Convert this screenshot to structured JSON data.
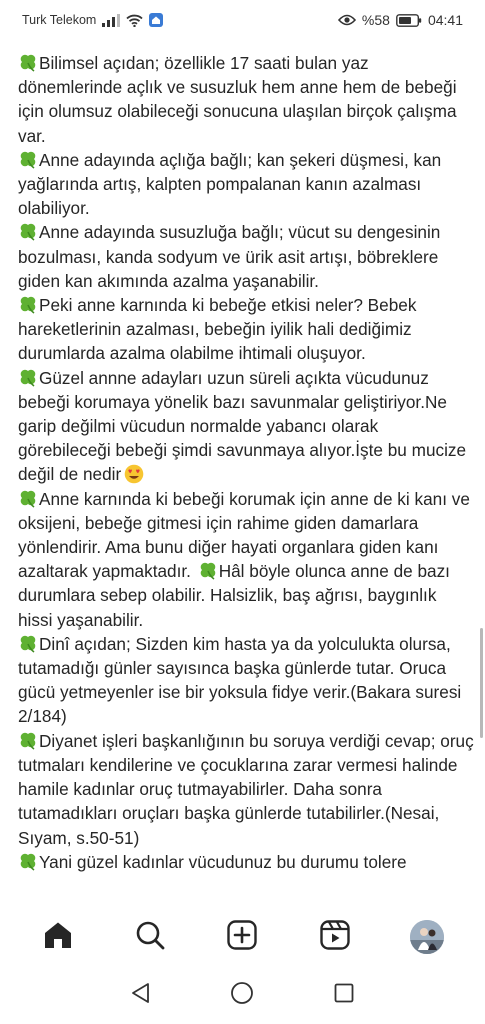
{
  "status_bar": {
    "carrier": "Turk Telekom",
    "battery_percent": "%58",
    "time": "04:41"
  },
  "caption": {
    "paragraphs": [
      {
        "text": "Bilimsel açıdan; özellikle 17 saati bulan  yaz dönemlerinde açlık ve susuzluk hem anne hem de bebeği için olumsuz olabileceği sonucuna ulaşılan birçok çalışma var."
      },
      {
        "text": "Anne adayında açlığa bağlı; kan şekeri düşmesi, kan yağlarında artış, kalpten pompalanan kanın azalması olabiliyor."
      },
      {
        "text": "Anne adayında susuzluğa bağlı; vücut su dengesinin bozulması, kanda sodyum ve ürik asit artışı, böbreklere giden kan akımında azalma yaşanabilir."
      },
      {
        "text": "Peki anne karnında ki bebeğe etkisi  neler? Bebek hareketlerinin azalması, bebeğin iyilik hali dediğimiz durumlarda azalma olabilme ihtimali oluşuyor."
      },
      {
        "text": "Güzel annne adayları uzun süreli açıkta vücudunuz bebeği korumaya yönelik bazı savunmalar geliştiriyor.Ne garip değilmi vücudun normalde yabancı olarak görebileceği bebeği şimdi savunmaya alıyor.İşte bu mucize değil de nedir"
      },
      {
        "text": "Anne karnında ki bebeği korumak için anne de ki kanı ve oksijeni, bebeğe gitmesi için rahime giden damarlara yönlendirir. Ama bunu diğer hayati organlara giden kanı azaltarak yapmaktadır.",
        "text2": "Hâl böyle olunca anne de bazı durumlara sebep olabilir. Halsizlik, baş ağrısı, baygınlık hissi yaşanabilir."
      },
      {
        "text": "Dinî açıdan; Sizden kim hasta ya da yolculukta olursa, tutamadığı günler sayısınca başka günlerde tutar. Oruca gücü yetmeyenler ise bir yoksula fidye verir.(Bakara suresi 2/184)"
      },
      {
        "text": "Diyanet işleri başkanlığının bu soruya verdiği cevap; oruç tutmaları kendilerine ve çocuklarına zarar vermesi halinde hamile kadınlar oruç tutmayabilirler. Daha sonra tutamadıkları oruçları başka günlerde tutabilirler.(Nesai, Sıyam, s.50-51)"
      },
      {
        "text": "Yani güzel kadınlar vücudunuz bu durumu tolere"
      }
    ]
  },
  "bottom_nav": {
    "items": [
      "home-icon",
      "search-icon",
      "new-post-icon",
      "reels-icon",
      "profile-avatar"
    ]
  },
  "system_nav": {
    "items": [
      "back-icon",
      "home-circle-icon",
      "recents-icon"
    ]
  },
  "colors": {
    "text": "#262626",
    "clover": "#5fb132",
    "icon": "#262626"
  }
}
